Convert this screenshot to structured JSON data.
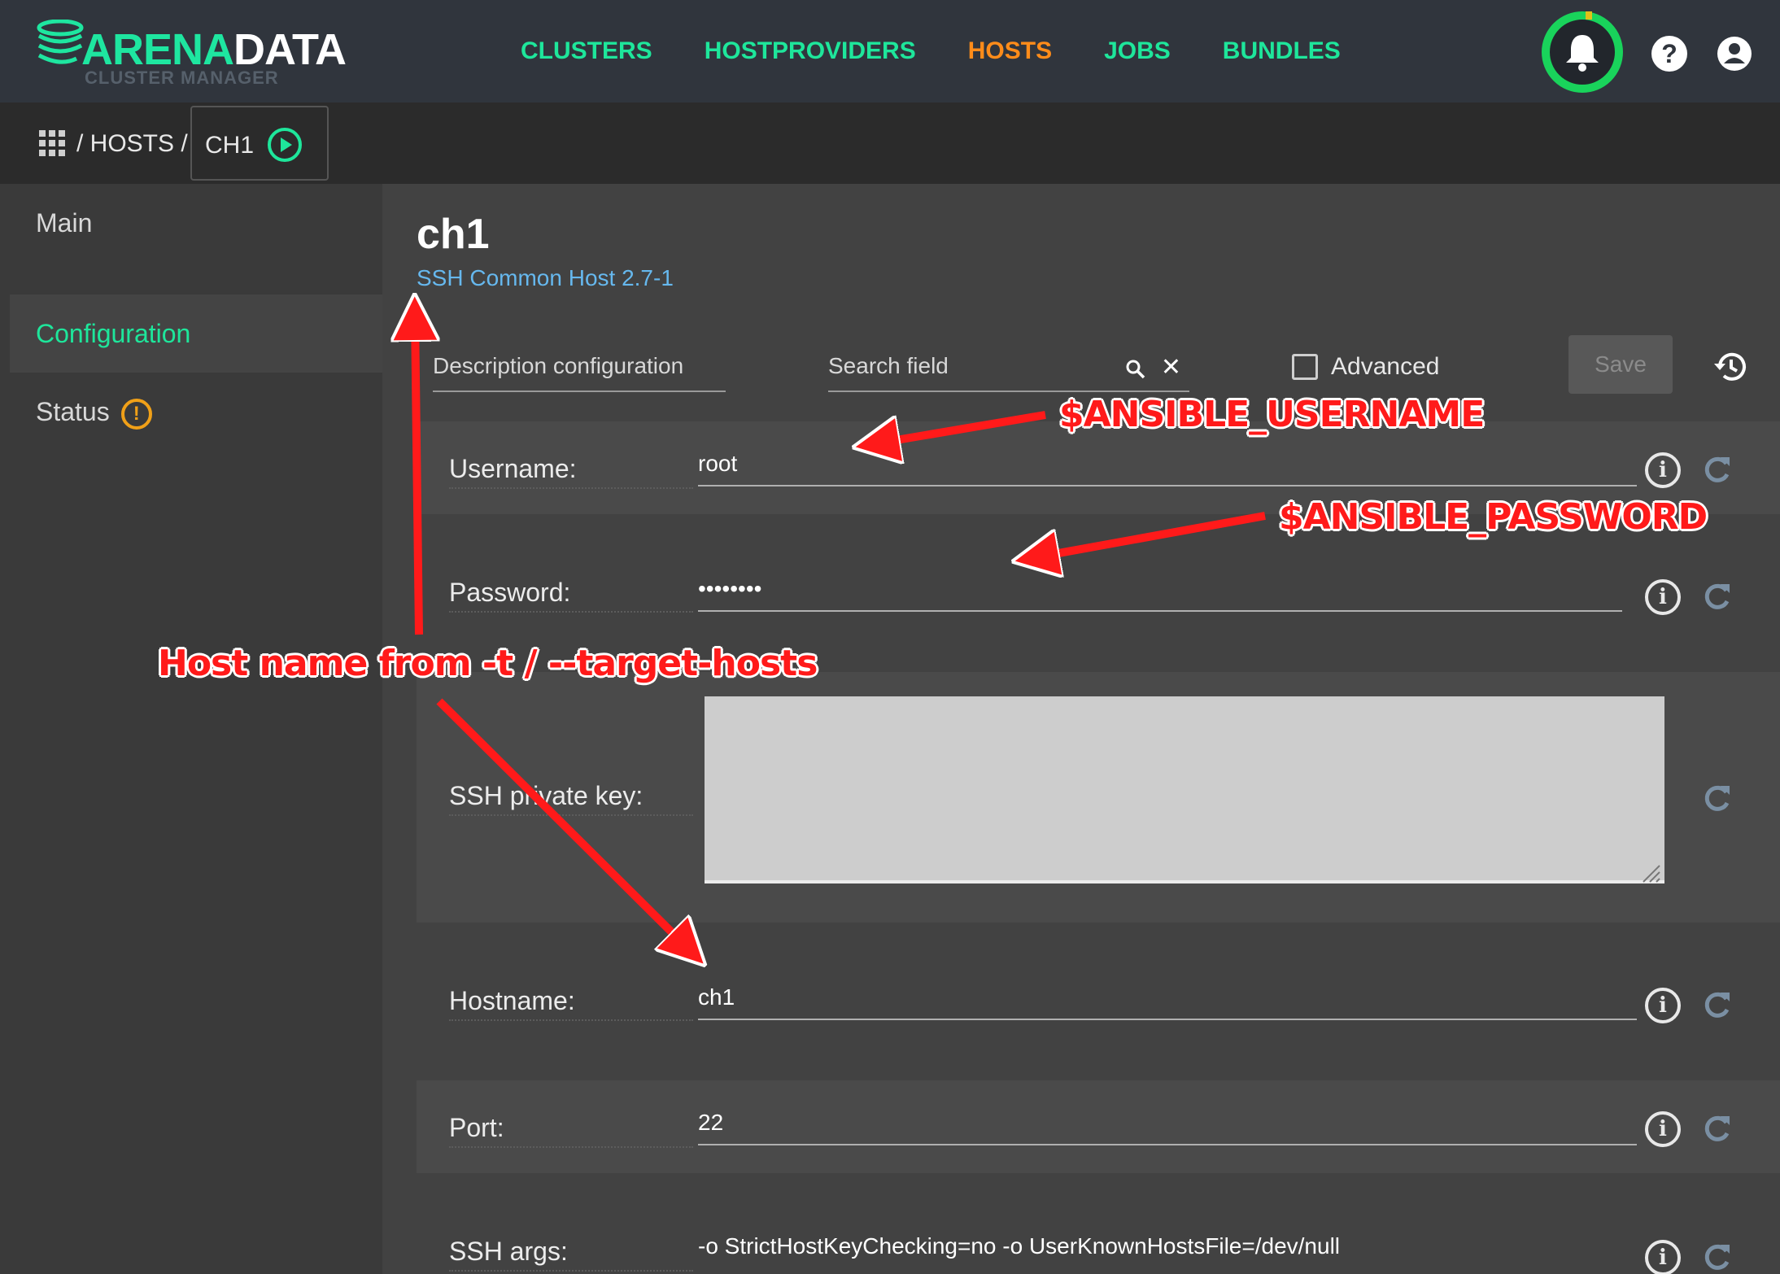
{
  "app": {
    "logo_primary": "ARENA",
    "logo_secondary": "DATA",
    "logo_sub": "CLUSTER MANAGER"
  },
  "nav": {
    "items": [
      {
        "label": "CLUSTERS",
        "active": false
      },
      {
        "label": "HOSTPROVIDERS",
        "active": false
      },
      {
        "label": "HOSTS",
        "active": true
      },
      {
        "label": "JOBS",
        "active": false
      },
      {
        "label": "BUNDLES",
        "active": false
      }
    ],
    "help_glyph": "?"
  },
  "breadcrumb": {
    "path": "/ HOSTS /",
    "current": "CH1"
  },
  "sidebar": {
    "items": [
      {
        "label": "Main",
        "active": false
      },
      {
        "label": "Configuration",
        "active": true
      },
      {
        "label": "Status",
        "active": false
      }
    ],
    "status_glyph": "!"
  },
  "host": {
    "title": "ch1",
    "subtitle": "SSH Common Host 2.7-1"
  },
  "toolbar": {
    "description_placeholder": "Description configuration",
    "search_placeholder": "Search field",
    "advanced_label": "Advanced",
    "save_label": "Save"
  },
  "fields": [
    {
      "label": "Username:",
      "value": "root"
    },
    {
      "label": "Password:",
      "value": "••••••••"
    },
    {
      "label": "SSH private key:",
      "value": ""
    },
    {
      "label": "Hostname:",
      "value": "ch1"
    },
    {
      "label": "Port:",
      "value": "22"
    },
    {
      "label": "SSH args:",
      "value": "-o StrictHostKeyChecking=no -o UserKnownHostsFile=/dev/null"
    }
  ],
  "annotations": {
    "username": "$ANSIBLE_USERNAME",
    "password": "$ANSIBLE_PASSWORD",
    "hostname": "Host name from -t / --target-hosts"
  },
  "colors": {
    "accent": "#1ee69b",
    "active_nav": "#ff8c1a",
    "link": "#66b8ee",
    "warning": "#f0a018",
    "annotation": "#ff1a1a"
  },
  "icons": [
    "apps-grid-icon",
    "play-circle-icon",
    "bell-icon",
    "help-icon",
    "user-icon",
    "warning-icon",
    "search-icon",
    "close-icon",
    "history-icon",
    "info-icon",
    "reset-icon"
  ]
}
